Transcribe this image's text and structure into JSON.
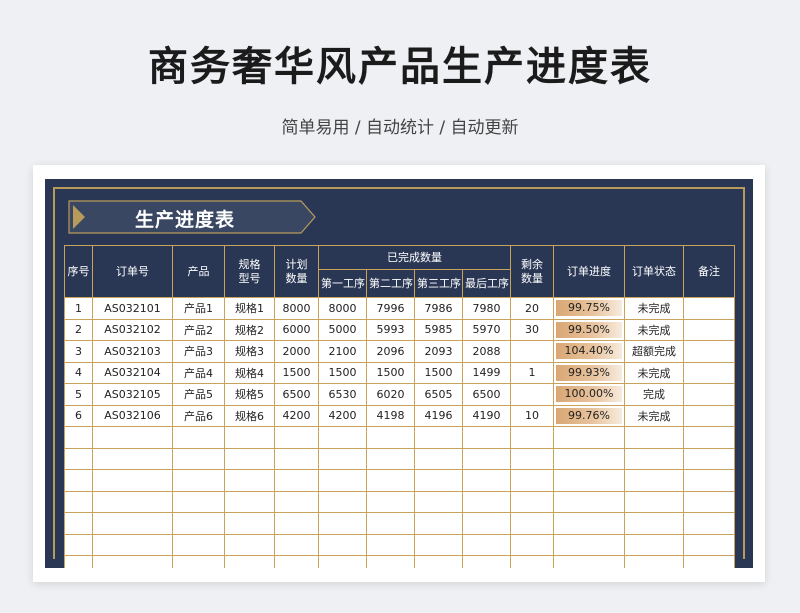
{
  "page": {
    "title": "商务奢华风产品生产进度表",
    "subtitle": "简单易用 / 自动统计 / 自动更新"
  },
  "sheet": {
    "banner": "生产进度表",
    "headers": {
      "seq": "序号",
      "order_no": "订单号",
      "product": "产品",
      "spec": "规格\n型号",
      "plan": "计划\n数量",
      "completed": "已完成数量",
      "step1": "第一工序",
      "step2": "第二工序",
      "step3": "第三工序",
      "last": "最后工序",
      "remain": "剩余\n数量",
      "progress": "订单进度",
      "status": "订单状态",
      "note": "备注"
    },
    "rows": [
      {
        "seq": "1",
        "order_no": "AS032101",
        "product": "产品1",
        "spec": "规格1",
        "plan": "8000",
        "s1": "8000",
        "s2": "7996",
        "s3": "7986",
        "last": "7980",
        "remain": "20",
        "progress": "99.75%",
        "progress_value": 99.75,
        "status": "未完成",
        "note": ""
      },
      {
        "seq": "2",
        "order_no": "AS032102",
        "product": "产品2",
        "spec": "规格2",
        "plan": "6000",
        "s1": "5000",
        "s2": "5993",
        "s3": "5985",
        "last": "5970",
        "remain": "30",
        "progress": "99.50%",
        "progress_value": 99.5,
        "status": "未完成",
        "note": ""
      },
      {
        "seq": "3",
        "order_no": "AS032103",
        "product": "产品3",
        "spec": "规格3",
        "plan": "2000",
        "s1": "2100",
        "s2": "2096",
        "s3": "2093",
        "last": "2088",
        "remain": "",
        "progress": "104.40%",
        "progress_value": 104.4,
        "status": "超额完成",
        "note": ""
      },
      {
        "seq": "4",
        "order_no": "AS032104",
        "product": "产品4",
        "spec": "规格4",
        "plan": "1500",
        "s1": "1500",
        "s2": "1500",
        "s3": "1500",
        "last": "1499",
        "remain": "1",
        "progress": "99.93%",
        "progress_value": 99.93,
        "status": "未完成",
        "note": ""
      },
      {
        "seq": "5",
        "order_no": "AS032105",
        "product": "产品5",
        "spec": "规格5",
        "plan": "6500",
        "s1": "6530",
        "s2": "6020",
        "s3": "6505",
        "last": "6500",
        "remain": "",
        "progress": "100.00%",
        "progress_value": 100.0,
        "status": "完成",
        "note": ""
      },
      {
        "seq": "6",
        "order_no": "AS032106",
        "product": "产品6",
        "spec": "规格6",
        "plan": "4200",
        "s1": "4200",
        "s2": "4198",
        "s3": "4196",
        "last": "4190",
        "remain": "10",
        "progress": "99.76%",
        "progress_value": 99.76,
        "status": "未完成",
        "note": ""
      }
    ],
    "empty_rows": 7
  },
  "colors": {
    "navy": "#2a3754",
    "gold": "#b89a5a",
    "grid": "#c9a35a",
    "bar_start": "#d9a774"
  }
}
